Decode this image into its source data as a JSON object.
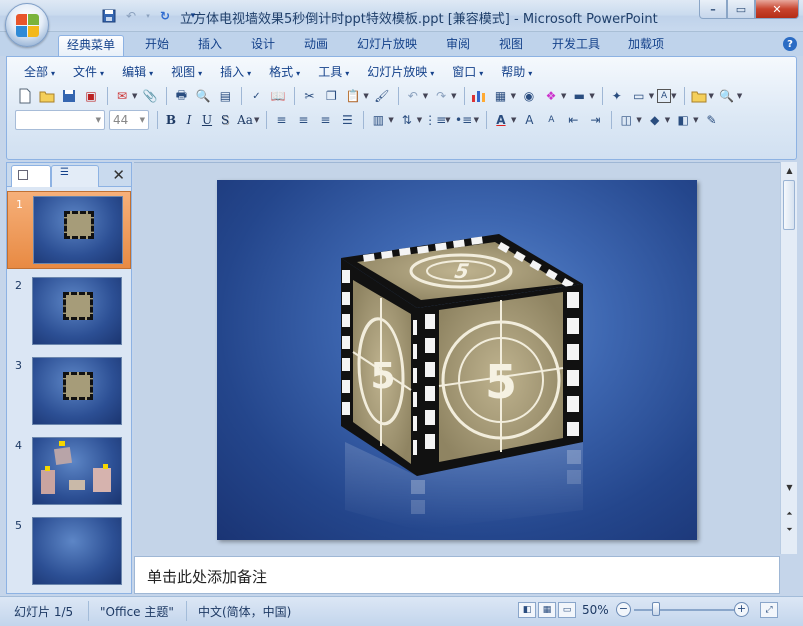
{
  "window": {
    "title": "立方体电视墙效果5秒倒计时ppt特效模板.ppt [兼容模式] - Microsoft PowerPoint",
    "minimize": "–",
    "maximize": "▭",
    "close": "✕"
  },
  "quick_access": [
    {
      "name": "save-icon",
      "glyph": "💾"
    },
    {
      "name": "undo-icon",
      "glyph": "↶"
    },
    {
      "name": "redo-icon",
      "glyph": "↷"
    },
    {
      "name": "customize-icon",
      "glyph": "▾"
    }
  ],
  "ribbon_tabs": [
    "经典菜单",
    "开始",
    "插入",
    "设计",
    "动画",
    "幻灯片放映",
    "审阅",
    "视图",
    "开发工具",
    "加载项"
  ],
  "help": "?",
  "menus": [
    "全部",
    "文件",
    "编辑",
    "视图",
    "插入",
    "格式",
    "工具",
    "幻灯片放映",
    "窗口",
    "帮助"
  ],
  "font": {
    "name": "",
    "size": "44"
  },
  "format_buttons": [
    "B",
    "I",
    "U",
    "S",
    "Aa"
  ],
  "slides": [
    {
      "number": "1",
      "kind": "cube",
      "selected": true
    },
    {
      "number": "2",
      "kind": "cube",
      "selected": false
    },
    {
      "number": "3",
      "kind": "cube",
      "selected": false
    },
    {
      "number": "4",
      "kind": "scatter",
      "selected": false
    },
    {
      "number": "5",
      "kind": "blank",
      "selected": false
    }
  ],
  "cube": {
    "digit": "5"
  },
  "notes": {
    "placeholder": "单击此处添加备注"
  },
  "status": {
    "slide": "幻灯片 1/5",
    "theme": "\"Office 主题\"",
    "language": "中文(简体，中国)",
    "zoom": "50%"
  },
  "colors": {
    "accent": "#15428b",
    "selection": "#e88a43",
    "slide_bg": "#2c4f94"
  }
}
